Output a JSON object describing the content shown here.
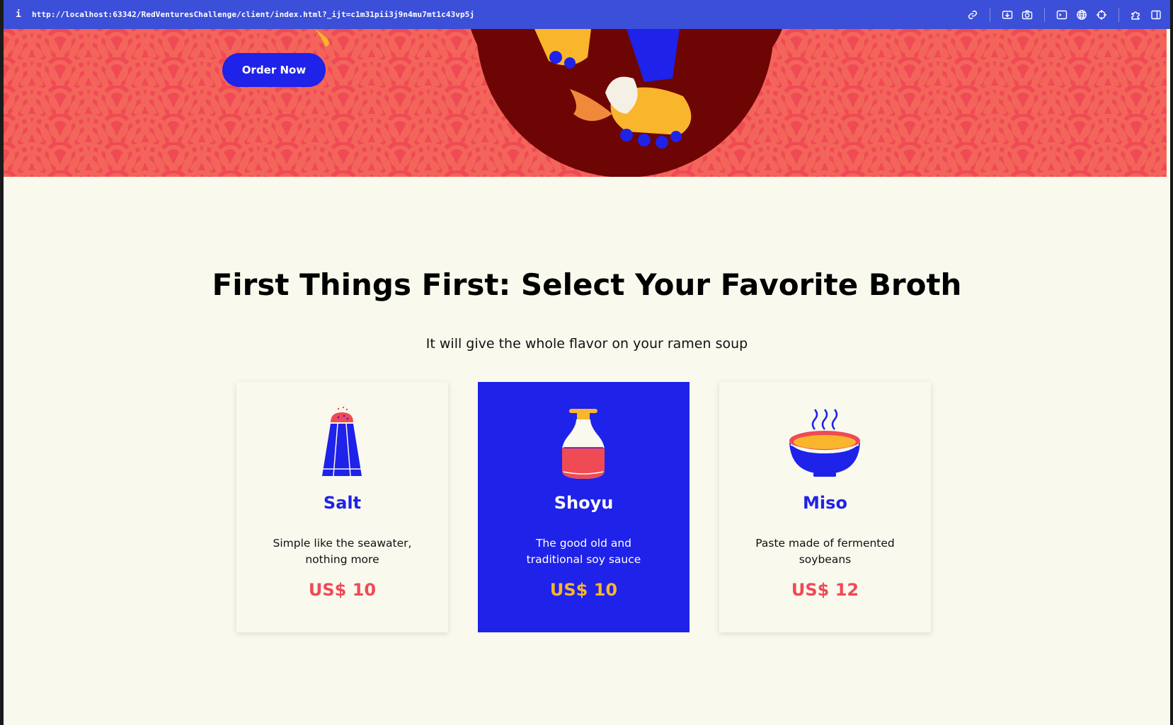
{
  "browser": {
    "info_icon": "i",
    "url": "http://localhost:63342/RedVenturesChallenge/client/index.html?_ijt=c1m31pii3j9n4mu7mt1c43vp5j",
    "toolbar_icons": [
      "link-icon",
      "download-icon",
      "camera-icon",
      "terminal-icon",
      "globe-icon",
      "crosshair-icon",
      "extensions-icon",
      "sidebar-icon"
    ]
  },
  "hero": {
    "order_button": "Order Now"
  },
  "section": {
    "title": "First Things First: Select Your Favorite Broth",
    "subtitle": "It will give the whole flavor on your ramen soup"
  },
  "broths": [
    {
      "name": "Salt",
      "description": "Simple like the seawater, nothing more",
      "price": "US$ 10",
      "icon": "salt-shaker-icon",
      "selected": false
    },
    {
      "name": "Shoyu",
      "description": "The good old and traditional soy sauce",
      "price": "US$ 10",
      "icon": "soy-sauce-bottle-icon",
      "selected": true
    },
    {
      "name": "Miso",
      "description": "Paste made of fermented soybeans",
      "price": "US$ 12",
      "icon": "miso-bowl-icon",
      "selected": false
    }
  ],
  "colors": {
    "brand_blue": "#1f22e8",
    "accent_red": "#f04a55",
    "accent_yellow": "#f9b52c",
    "background": "#f9f9ee",
    "browser_bar": "#3b4fd8"
  }
}
